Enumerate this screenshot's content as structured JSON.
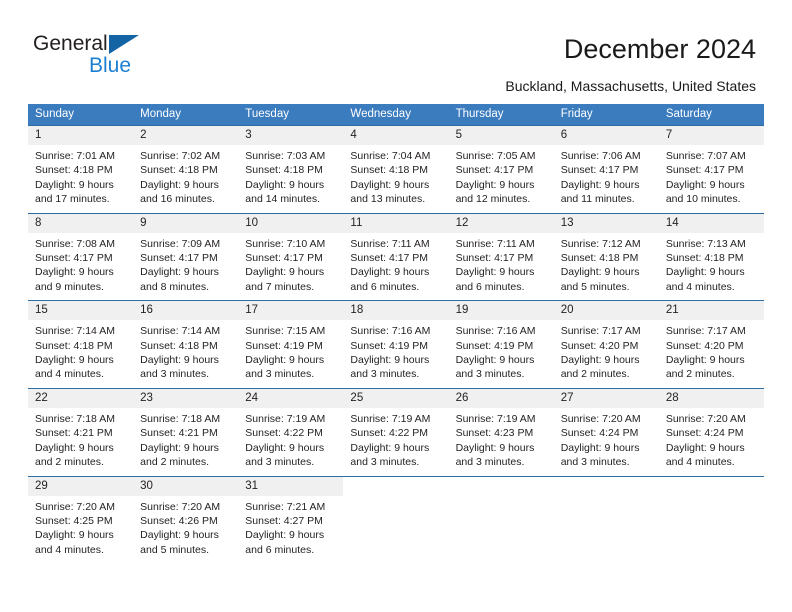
{
  "brand": {
    "name_part1": "General",
    "name_part2": "Blue",
    "accent_color": "#1d7fd1",
    "triangle_color": "#1464a5"
  },
  "header": {
    "title": "December 2024",
    "location": "Buckland, Massachusetts, United States"
  },
  "calendar": {
    "header_bg": "#3b7cbf",
    "daynum_bg": "#f0f0f0",
    "weekdays": [
      "Sunday",
      "Monday",
      "Tuesday",
      "Wednesday",
      "Thursday",
      "Friday",
      "Saturday"
    ],
    "weeks": [
      [
        {
          "day": "1",
          "sunrise": "Sunrise: 7:01 AM",
          "sunset": "Sunset: 4:18 PM",
          "daylight1": "Daylight: 9 hours",
          "daylight2": "and 17 minutes."
        },
        {
          "day": "2",
          "sunrise": "Sunrise: 7:02 AM",
          "sunset": "Sunset: 4:18 PM",
          "daylight1": "Daylight: 9 hours",
          "daylight2": "and 16 minutes."
        },
        {
          "day": "3",
          "sunrise": "Sunrise: 7:03 AM",
          "sunset": "Sunset: 4:18 PM",
          "daylight1": "Daylight: 9 hours",
          "daylight2": "and 14 minutes."
        },
        {
          "day": "4",
          "sunrise": "Sunrise: 7:04 AM",
          "sunset": "Sunset: 4:18 PM",
          "daylight1": "Daylight: 9 hours",
          "daylight2": "and 13 minutes."
        },
        {
          "day": "5",
          "sunrise": "Sunrise: 7:05 AM",
          "sunset": "Sunset: 4:17 PM",
          "daylight1": "Daylight: 9 hours",
          "daylight2": "and 12 minutes."
        },
        {
          "day": "6",
          "sunrise": "Sunrise: 7:06 AM",
          "sunset": "Sunset: 4:17 PM",
          "daylight1": "Daylight: 9 hours",
          "daylight2": "and 11 minutes."
        },
        {
          "day": "7",
          "sunrise": "Sunrise: 7:07 AM",
          "sunset": "Sunset: 4:17 PM",
          "daylight1": "Daylight: 9 hours",
          "daylight2": "and 10 minutes."
        }
      ],
      [
        {
          "day": "8",
          "sunrise": "Sunrise: 7:08 AM",
          "sunset": "Sunset: 4:17 PM",
          "daylight1": "Daylight: 9 hours",
          "daylight2": "and 9 minutes."
        },
        {
          "day": "9",
          "sunrise": "Sunrise: 7:09 AM",
          "sunset": "Sunset: 4:17 PM",
          "daylight1": "Daylight: 9 hours",
          "daylight2": "and 8 minutes."
        },
        {
          "day": "10",
          "sunrise": "Sunrise: 7:10 AM",
          "sunset": "Sunset: 4:17 PM",
          "daylight1": "Daylight: 9 hours",
          "daylight2": "and 7 minutes."
        },
        {
          "day": "11",
          "sunrise": "Sunrise: 7:11 AM",
          "sunset": "Sunset: 4:17 PM",
          "daylight1": "Daylight: 9 hours",
          "daylight2": "and 6 minutes."
        },
        {
          "day": "12",
          "sunrise": "Sunrise: 7:11 AM",
          "sunset": "Sunset: 4:17 PM",
          "daylight1": "Daylight: 9 hours",
          "daylight2": "and 6 minutes."
        },
        {
          "day": "13",
          "sunrise": "Sunrise: 7:12 AM",
          "sunset": "Sunset: 4:18 PM",
          "daylight1": "Daylight: 9 hours",
          "daylight2": "and 5 minutes."
        },
        {
          "day": "14",
          "sunrise": "Sunrise: 7:13 AM",
          "sunset": "Sunset: 4:18 PM",
          "daylight1": "Daylight: 9 hours",
          "daylight2": "and 4 minutes."
        }
      ],
      [
        {
          "day": "15",
          "sunrise": "Sunrise: 7:14 AM",
          "sunset": "Sunset: 4:18 PM",
          "daylight1": "Daylight: 9 hours",
          "daylight2": "and 4 minutes."
        },
        {
          "day": "16",
          "sunrise": "Sunrise: 7:14 AM",
          "sunset": "Sunset: 4:18 PM",
          "daylight1": "Daylight: 9 hours",
          "daylight2": "and 3 minutes."
        },
        {
          "day": "17",
          "sunrise": "Sunrise: 7:15 AM",
          "sunset": "Sunset: 4:19 PM",
          "daylight1": "Daylight: 9 hours",
          "daylight2": "and 3 minutes."
        },
        {
          "day": "18",
          "sunrise": "Sunrise: 7:16 AM",
          "sunset": "Sunset: 4:19 PM",
          "daylight1": "Daylight: 9 hours",
          "daylight2": "and 3 minutes."
        },
        {
          "day": "19",
          "sunrise": "Sunrise: 7:16 AM",
          "sunset": "Sunset: 4:19 PM",
          "daylight1": "Daylight: 9 hours",
          "daylight2": "and 3 minutes."
        },
        {
          "day": "20",
          "sunrise": "Sunrise: 7:17 AM",
          "sunset": "Sunset: 4:20 PM",
          "daylight1": "Daylight: 9 hours",
          "daylight2": "and 2 minutes."
        },
        {
          "day": "21",
          "sunrise": "Sunrise: 7:17 AM",
          "sunset": "Sunset: 4:20 PM",
          "daylight1": "Daylight: 9 hours",
          "daylight2": "and 2 minutes."
        }
      ],
      [
        {
          "day": "22",
          "sunrise": "Sunrise: 7:18 AM",
          "sunset": "Sunset: 4:21 PM",
          "daylight1": "Daylight: 9 hours",
          "daylight2": "and 2 minutes."
        },
        {
          "day": "23",
          "sunrise": "Sunrise: 7:18 AM",
          "sunset": "Sunset: 4:21 PM",
          "daylight1": "Daylight: 9 hours",
          "daylight2": "and 2 minutes."
        },
        {
          "day": "24",
          "sunrise": "Sunrise: 7:19 AM",
          "sunset": "Sunset: 4:22 PM",
          "daylight1": "Daylight: 9 hours",
          "daylight2": "and 3 minutes."
        },
        {
          "day": "25",
          "sunrise": "Sunrise: 7:19 AM",
          "sunset": "Sunset: 4:22 PM",
          "daylight1": "Daylight: 9 hours",
          "daylight2": "and 3 minutes."
        },
        {
          "day": "26",
          "sunrise": "Sunrise: 7:19 AM",
          "sunset": "Sunset: 4:23 PM",
          "daylight1": "Daylight: 9 hours",
          "daylight2": "and 3 minutes."
        },
        {
          "day": "27",
          "sunrise": "Sunrise: 7:20 AM",
          "sunset": "Sunset: 4:24 PM",
          "daylight1": "Daylight: 9 hours",
          "daylight2": "and 3 minutes."
        },
        {
          "day": "28",
          "sunrise": "Sunrise: 7:20 AM",
          "sunset": "Sunset: 4:24 PM",
          "daylight1": "Daylight: 9 hours",
          "daylight2": "and 4 minutes."
        }
      ],
      [
        {
          "day": "29",
          "sunrise": "Sunrise: 7:20 AM",
          "sunset": "Sunset: 4:25 PM",
          "daylight1": "Daylight: 9 hours",
          "daylight2": "and 4 minutes."
        },
        {
          "day": "30",
          "sunrise": "Sunrise: 7:20 AM",
          "sunset": "Sunset: 4:26 PM",
          "daylight1": "Daylight: 9 hours",
          "daylight2": "and 5 minutes."
        },
        {
          "day": "31",
          "sunrise": "Sunrise: 7:21 AM",
          "sunset": "Sunset: 4:27 PM",
          "daylight1": "Daylight: 9 hours",
          "daylight2": "and 6 minutes."
        },
        {
          "day": "",
          "sunrise": "",
          "sunset": "",
          "daylight1": "",
          "daylight2": ""
        },
        {
          "day": "",
          "sunrise": "",
          "sunset": "",
          "daylight1": "",
          "daylight2": ""
        },
        {
          "day": "",
          "sunrise": "",
          "sunset": "",
          "daylight1": "",
          "daylight2": ""
        },
        {
          "day": "",
          "sunrise": "",
          "sunset": "",
          "daylight1": "",
          "daylight2": ""
        }
      ]
    ]
  }
}
